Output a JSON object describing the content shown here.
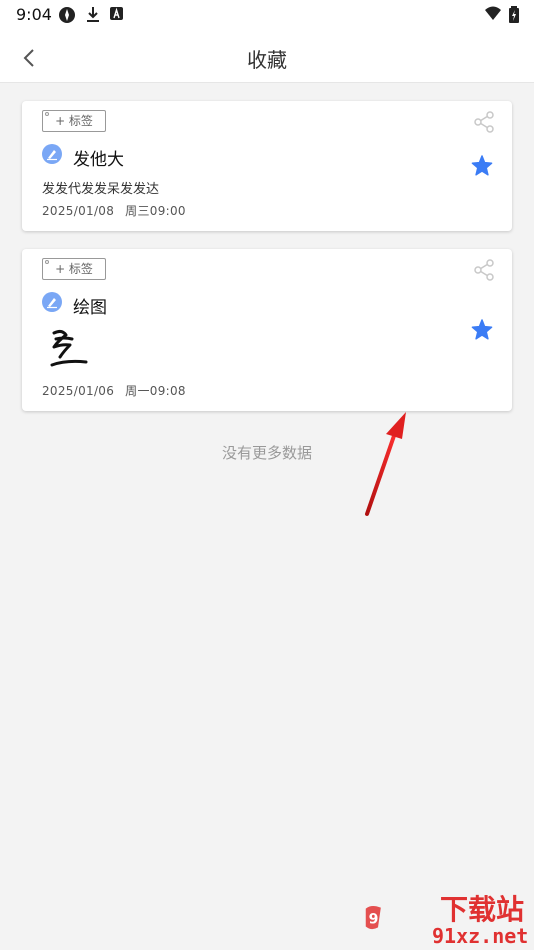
{
  "status_bar": {
    "time": "9:04"
  },
  "header": {
    "title": "收藏"
  },
  "notes": [
    {
      "tag_label": "+ 标签",
      "title": "发他大",
      "body": "发发代发发呆发发达",
      "date": "2025/01/08",
      "weekday_time": "周三09:00",
      "has_drawing": false
    },
    {
      "tag_label": "+ 标签",
      "title": "绘图",
      "date": "2025/01/06",
      "weekday_time": "周一09:08",
      "has_drawing": true
    }
  ],
  "footer_text": "没有更多数据",
  "watermark": {
    "line1": "下载站",
    "line2": "91xz.net"
  },
  "colors": {
    "accent": "#3b7cf5",
    "arrow": "#e02020",
    "watermark": "#e03131"
  }
}
